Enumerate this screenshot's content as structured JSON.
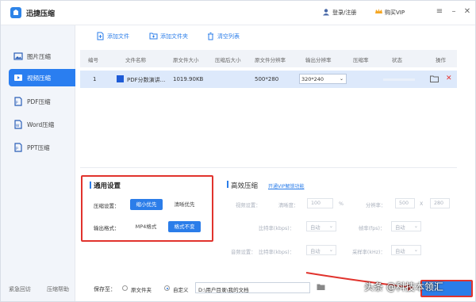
{
  "app": {
    "title": "迅捷压缩",
    "login": "登录/注册",
    "vip": "购买VIP"
  },
  "sidebar": {
    "items": [
      {
        "label": "图片压缩",
        "icon": "image-icon"
      },
      {
        "label": "视频压缩",
        "icon": "video-icon",
        "active": true
      },
      {
        "label": "PDF压缩",
        "icon": "pdf-icon"
      },
      {
        "label": "Word压缩",
        "icon": "word-icon"
      },
      {
        "label": "PPT压缩",
        "icon": "ppt-icon"
      }
    ],
    "footer_left": "紧急回访",
    "footer_right": "压缩帮助"
  },
  "toolbar": {
    "add_file": "添加文件",
    "add_folder": "添加文件夹",
    "clear_list": "清空列表"
  },
  "table": {
    "headers": [
      "编号",
      "文件名称",
      "原文件大小",
      "压缩后大小",
      "原文件分辨率",
      "输出分辨率",
      "压缩率",
      "状态",
      "操作"
    ],
    "rows": [
      {
        "index": "1",
        "name": "PDF分数演讲...",
        "size": "1019.90KB",
        "compressed": "",
        "source_res": "500*280",
        "output_res": "320*240",
        "ratio": "",
        "status": ""
      }
    ]
  },
  "general_settings": {
    "title": "通用设置",
    "compress_label": "压缩设置：",
    "compress_options": [
      "缩小优先",
      "清晰优先"
    ],
    "format_label": "输出格式：",
    "format_value": "MP4格式",
    "format_keep": "格式不变"
  },
  "advanced": {
    "title": "高效压缩",
    "link": "开通VIP解锁功能",
    "video_label": "视频设置：",
    "clarity_label": "清晰度：",
    "clarity_value": "100",
    "percent": "%",
    "resolution_label": "分辨率：",
    "res_w": "500",
    "res_x": "X",
    "res_h": "280",
    "bitrate_label": "比特率(kbps)：",
    "bitrate_value": "自动",
    "fps_label": "帧率(fps)：",
    "fps_value": "自动",
    "audio_label": "音频设置：",
    "audio_bitrate_label": "比特率(kbps)：",
    "audio_bitrate_value": "自动",
    "sample_label": "采样率(kHz)：",
    "sample_value": "自动"
  },
  "footer": {
    "save_label": "保存至：",
    "original_folder": "原文件夹",
    "custom": "自定义",
    "path": "D:\\用户目录\\我的文档"
  },
  "watermark": "头条 @科技本领汇"
}
